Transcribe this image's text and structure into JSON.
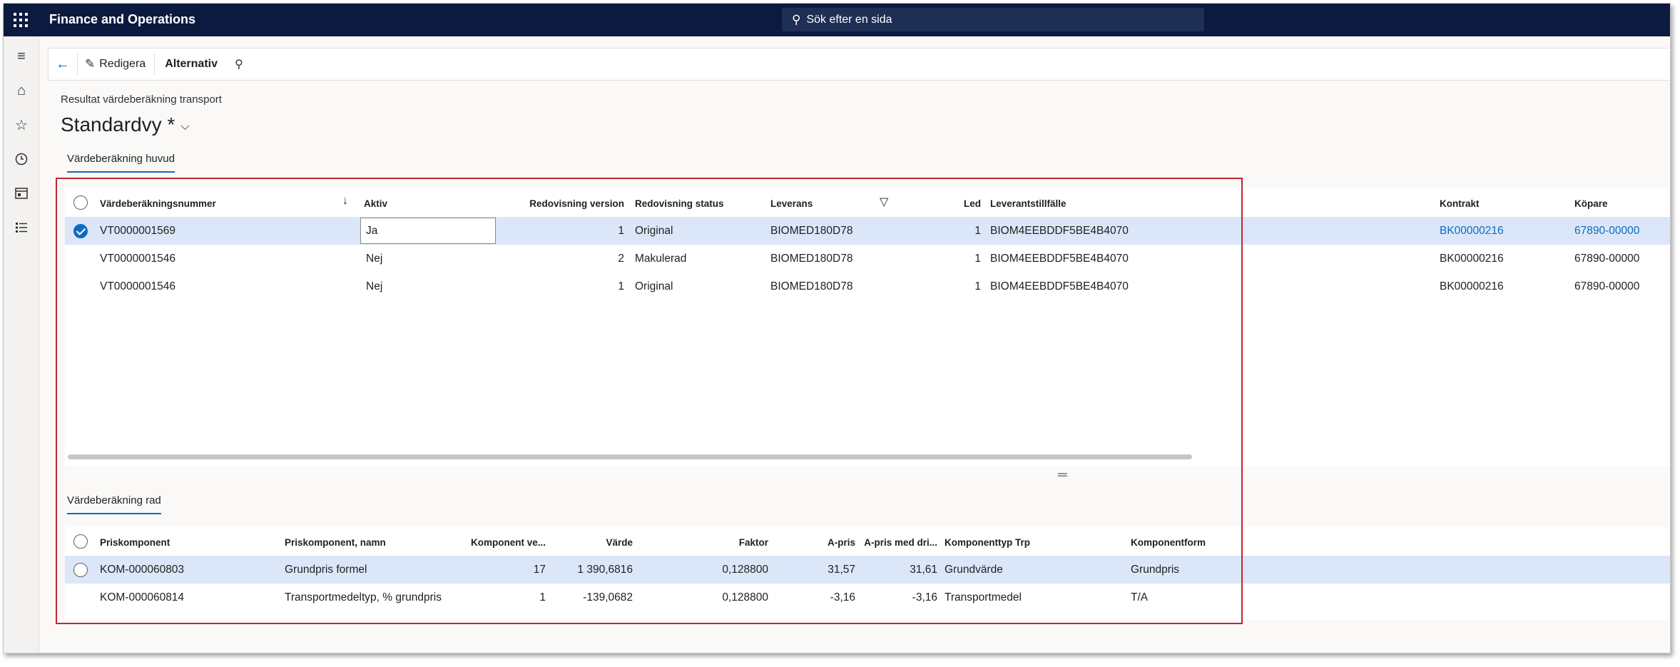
{
  "app": {
    "title": "Finance and Operations",
    "search_placeholder": "Sök efter en sida"
  },
  "nav": {
    "icons": [
      "hamburger-icon",
      "home-icon",
      "star-icon",
      "clock-icon",
      "workspace-icon",
      "list-icon"
    ]
  },
  "actionbar": {
    "edit_label": "Redigera",
    "options_label": "Alternativ"
  },
  "page": {
    "breadcrumb": "Resultat värdeberäkning transport",
    "view_title": "Standardvy *"
  },
  "header_tab": {
    "label": "Värdeberäkning huvud"
  },
  "header_grid": {
    "columns": {
      "number": "Värdeberäkningsnummer",
      "active": "Aktiv",
      "acc_version": "Redovisning version",
      "acc_status": "Redovisning status",
      "delivery": "Leverans",
      "leg": "Led",
      "supplier_occasion": "Leverantstillfälle",
      "contract": "Kontrakt",
      "buyer": "Köpare"
    },
    "rows": [
      {
        "number": "VT0000001569",
        "active": "Ja",
        "acc_version": "1",
        "acc_status": "Original",
        "delivery": "BIOMED180D78",
        "leg": "1",
        "supplier_occasion": "BIOM4EEBDDF5BE4B4070",
        "contract": "BK00000216",
        "buyer": "67890-00000"
      },
      {
        "number": "VT0000001546",
        "active": "Nej",
        "acc_version": "2",
        "acc_status": "Makulerad",
        "delivery": "BIOMED180D78",
        "leg": "1",
        "supplier_occasion": "BIOM4EEBDDF5BE4B4070",
        "contract": "BK00000216",
        "buyer": "67890-00000"
      },
      {
        "number": "VT0000001546",
        "active": "Nej",
        "acc_version": "1",
        "acc_status": "Original",
        "delivery": "BIOMED180D78",
        "leg": "1",
        "supplier_occasion": "BIOM4EEBDDF5BE4B4070",
        "contract": "BK00000216",
        "buyer": "67890-00000"
      }
    ]
  },
  "line_tab": {
    "label": "Värdeberäkning rad"
  },
  "line_grid": {
    "columns": {
      "component": "Priskomponent",
      "component_name": "Priskomponent, namn",
      "component_version": "Komponent ve...",
      "value": "Värde",
      "factor": "Faktor",
      "unit_price": "A-pris",
      "unit_price_op": "A-pris med dri...",
      "component_type": "Komponenttyp Trp",
      "component_form": "Komponentform"
    },
    "rows": [
      {
        "component": "KOM-000060803",
        "component_name": "Grundpris formel",
        "component_version": "17",
        "value": "1 390,6816",
        "factor": "0,128800",
        "unit_price": "31,57",
        "unit_price_op": "31,61",
        "component_type": "Grundvärde",
        "component_form": "Grundpris"
      },
      {
        "component": "KOM-000060814",
        "component_name": "Transportmedeltyp, % grundpris",
        "component_version": "1",
        "value": "-139,0682",
        "factor": "0,128800",
        "unit_price": "-3,16",
        "unit_price_op": "-3,16",
        "component_type": "Transportmedel",
        "component_form": "T/A"
      }
    ]
  },
  "colors": {
    "topbar": "#0c1a3f",
    "accent": "#0f6cbd",
    "selected_row": "#dbe7f9",
    "highlight_box": "#c4262e"
  }
}
